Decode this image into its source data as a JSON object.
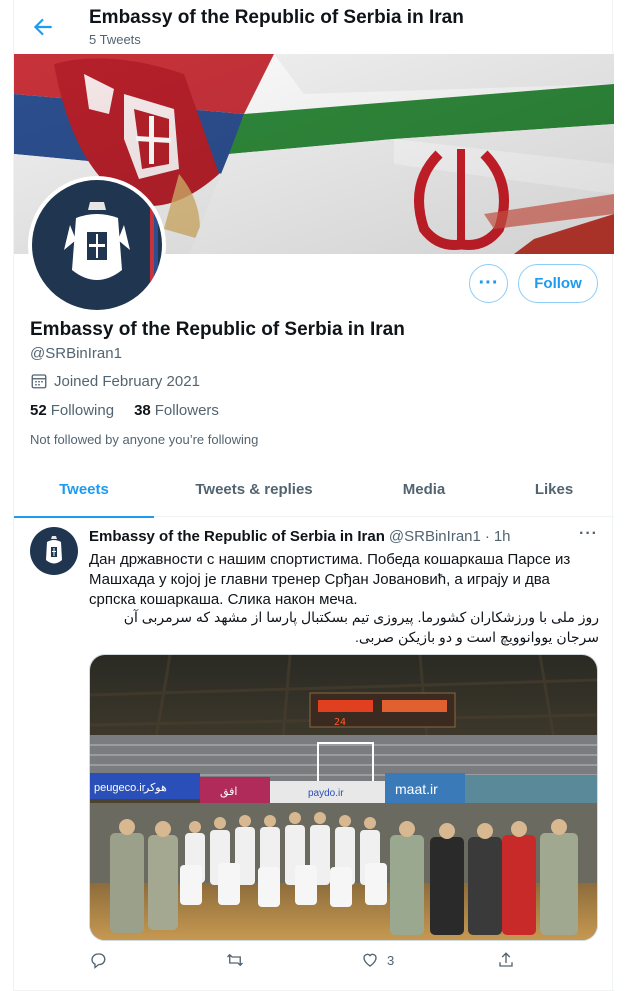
{
  "header": {
    "title": "Embassy of the Republic of Serbia in Iran",
    "tweet_count": "5 Tweets"
  },
  "profile": {
    "name": "Embassy of the Republic of Serbia in Iran",
    "handle": "@SRBinIran1",
    "joined": "Joined February 2021",
    "following_count": "52",
    "following_label": "Following",
    "followers_count": "38",
    "followers_label": "Followers",
    "not_followed_text": "Not followed by anyone you’re following",
    "follow_label": "Follow",
    "more_label": "···"
  },
  "tabs": [
    {
      "label": "Tweets",
      "active": true
    },
    {
      "label": "Tweets & replies",
      "active": false
    },
    {
      "label": "Media",
      "active": false
    },
    {
      "label": "Likes",
      "active": false
    }
  ],
  "tweet": {
    "author": "Embassy of the Republic of Serbia in Iran",
    "handle": "@SRBinIran1",
    "separator": "·",
    "time": "1h",
    "more": "···",
    "text_cyrillic": "Дан државности с нашим спортистима. Победа кошаркаша Парсе из Машхада у којој је главни тренер Срђан Јовановић, а играју и два српска кошаркаша. Слика након меча.",
    "text_persian": "روز ملی با ورزشکاران کشورما. پیروزی تیم بسکتبال پارسا از مشهد که سرمربی آن سرجان یووانوویچ است و دو بازیکن صربی.",
    "photo_signage": {
      "scoreboard": "24",
      "sponsor_1": "peugeco.ir",
      "sponsor_2": "هوکر",
      "sponsor_3": "افق",
      "sponsor_4": "paydo.ir",
      "sponsor_5": "maat.ir"
    },
    "likes_count": "3"
  },
  "colors": {
    "accent": "#1d9bf0",
    "secondary_text": "#536471",
    "primary_text": "#0f1419",
    "border": "#eff3f4"
  },
  "icons": {
    "back": "arrow-left-icon",
    "calendar": "calendar-icon",
    "reply": "reply-icon",
    "retweet": "retweet-icon",
    "like": "heart-icon",
    "share": "share-icon"
  }
}
